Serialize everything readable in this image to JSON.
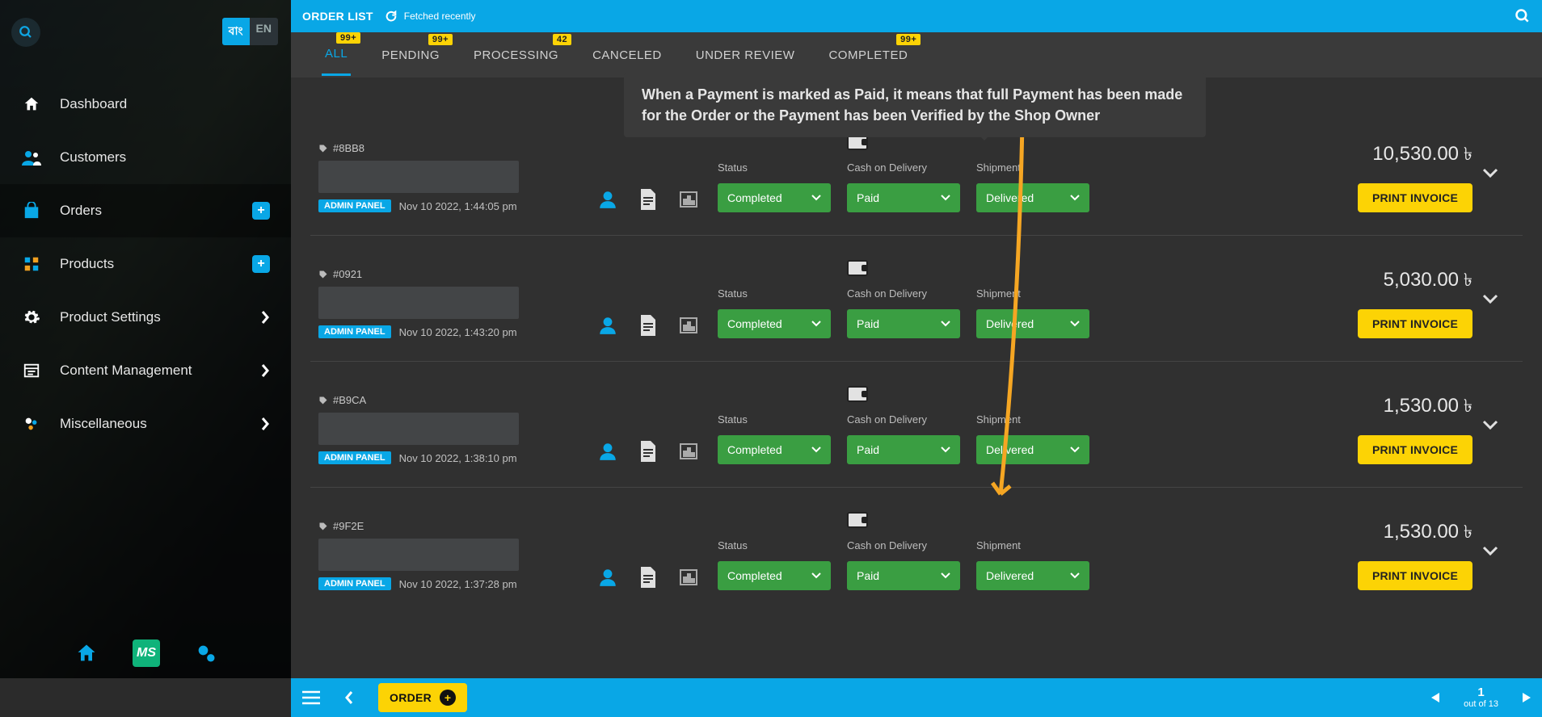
{
  "header": {
    "title": "ORDER LIST",
    "refresh": "Fetched recently"
  },
  "lang": {
    "bn": "বাং",
    "en": "EN"
  },
  "nav": [
    {
      "label": "Dashboard"
    },
    {
      "label": "Customers"
    },
    {
      "label": "Orders"
    },
    {
      "label": "Products"
    },
    {
      "label": "Product Settings"
    },
    {
      "label": "Content Management"
    },
    {
      "label": "Miscellaneous"
    }
  ],
  "tabs": [
    {
      "label": "ALL",
      "badge": "99+"
    },
    {
      "label": "PENDING",
      "badge": "99+"
    },
    {
      "label": "PROCESSING",
      "badge": "42"
    },
    {
      "label": "CANCELED"
    },
    {
      "label": "UNDER REVIEW"
    },
    {
      "label": "COMPLETED",
      "badge": "99+"
    }
  ],
  "tooltip": "When a Payment is marked as Paid, it means that full Payment has been made for the Order or the Payment has been Verified by the Shop Owner",
  "col_labels": {
    "status": "Status",
    "cod": "Cash on Delivery",
    "ship": "Shipment"
  },
  "sel": {
    "status": "Completed",
    "cod": "Paid",
    "ship": "Delivered"
  },
  "source": "ADMIN PANEL",
  "invoice_btn": "PRINT INVOICE",
  "orders": [
    {
      "id": "#8BB8",
      "date": "Nov 10 2022, 1:44:05 pm",
      "price": "10,530.00"
    },
    {
      "id": "#0921",
      "date": "Nov 10 2022, 1:43:20 pm",
      "price": "5,030.00"
    },
    {
      "id": "#B9CA",
      "date": "Nov 10 2022, 1:38:10 pm",
      "price": "1,530.00"
    },
    {
      "id": "#9F2E",
      "date": "Nov 10 2022, 1:37:28 pm",
      "price": "1,530.00"
    }
  ],
  "currency": "৳",
  "bottom": {
    "order": "ORDER",
    "page": "1",
    "outof": "out of 13"
  }
}
